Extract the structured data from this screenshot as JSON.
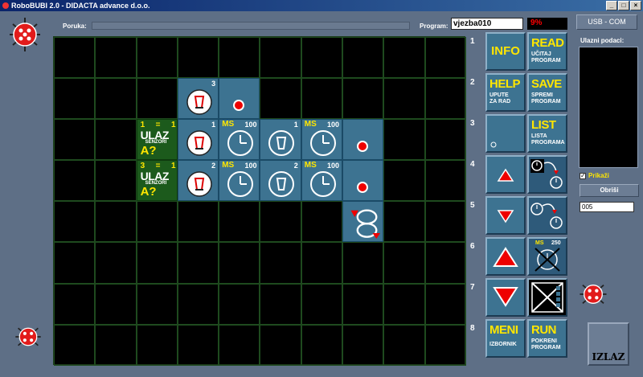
{
  "window": {
    "title": "RoboBUBI 2.0 - DIDACTA advance d.o.o."
  },
  "top": {
    "poruka_label": "Poruka:",
    "program_label": "Program:",
    "program_value": "vjezba010",
    "progress_text": "9%",
    "usb_label": "USB - COM"
  },
  "grid": {
    "r2c5_num": "3",
    "r3_cond": {
      "left": "1",
      "eq": "=",
      "right": "1",
      "ulaz": "ULAZ",
      "senzori": "SENZORI",
      "q": "A?"
    },
    "r3c5_num": "1",
    "r3c6_ms": "MS",
    "r3c6_val": "100",
    "r3c7_num": "1",
    "r3c8_ms": "MS",
    "r3c8_val": "100",
    "r4_cond": {
      "left": "3",
      "eq": "=",
      "right": "1",
      "ulaz": "ULAZ",
      "senzori": "SENZORI",
      "q": "A?"
    },
    "r4c5_num": "2",
    "r4c6_ms": "MS",
    "r4c6_val": "100",
    "r4c7_num": "2",
    "r4c8_ms": "MS",
    "r4c8_val": "100"
  },
  "rows": [
    "1",
    "2",
    "3",
    "4",
    "5",
    "6",
    "7",
    "8"
  ],
  "commands": {
    "info": "INFO",
    "read": "READ",
    "read_sub1": "UČITAJ",
    "read_sub2": "PROGRAM",
    "help": "HELP",
    "help_sub1": "UPUTE",
    "help_sub2": "ZA RAD",
    "save": "SAVE",
    "save_sub1": "SPREMI",
    "save_sub2": "PROGRAM",
    "list": "LIST",
    "list_sub1": "LISTA",
    "list_sub2": "PROGRAMA",
    "ms_label": "MS",
    "ms_val": "250",
    "meni": "MENI",
    "meni_sub": "IZBORNIK",
    "run": "RUN",
    "run_sub1": "POKRENI",
    "run_sub2": "PROGRAM"
  },
  "right_panel": {
    "ulazni_label": "Ulazni podaci:",
    "prikazi_label": "Prikaži",
    "prikazi_checked": "✓",
    "obrisi_label": "Obriši",
    "value_field": "005",
    "izlaz_label": "IZLAZ"
  },
  "colors": {
    "tile": "#3d7391",
    "accent_yellow": "#ffe600",
    "condition_green": "#1c5a1c",
    "background": "#5e6f86"
  }
}
